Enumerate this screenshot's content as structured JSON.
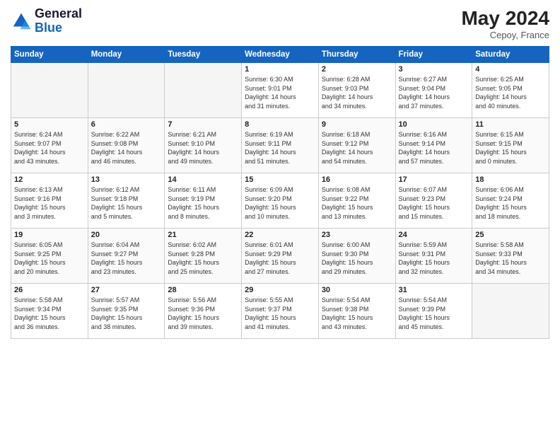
{
  "header": {
    "logo_general": "General",
    "logo_blue": "Blue",
    "month_year": "May 2024",
    "location": "Cepoy, France"
  },
  "days_of_week": [
    "Sunday",
    "Monday",
    "Tuesday",
    "Wednesday",
    "Thursday",
    "Friday",
    "Saturday"
  ],
  "weeks": [
    [
      {
        "day": "",
        "info": ""
      },
      {
        "day": "",
        "info": ""
      },
      {
        "day": "",
        "info": ""
      },
      {
        "day": "1",
        "info": "Sunrise: 6:30 AM\nSunset: 9:01 PM\nDaylight: 14 hours\nand 31 minutes."
      },
      {
        "day": "2",
        "info": "Sunrise: 6:28 AM\nSunset: 9:03 PM\nDaylight: 14 hours\nand 34 minutes."
      },
      {
        "day": "3",
        "info": "Sunrise: 6:27 AM\nSunset: 9:04 PM\nDaylight: 14 hours\nand 37 minutes."
      },
      {
        "day": "4",
        "info": "Sunrise: 6:25 AM\nSunset: 9:05 PM\nDaylight: 14 hours\nand 40 minutes."
      }
    ],
    [
      {
        "day": "5",
        "info": "Sunrise: 6:24 AM\nSunset: 9:07 PM\nDaylight: 14 hours\nand 43 minutes."
      },
      {
        "day": "6",
        "info": "Sunrise: 6:22 AM\nSunset: 9:08 PM\nDaylight: 14 hours\nand 46 minutes."
      },
      {
        "day": "7",
        "info": "Sunrise: 6:21 AM\nSunset: 9:10 PM\nDaylight: 14 hours\nand 49 minutes."
      },
      {
        "day": "8",
        "info": "Sunrise: 6:19 AM\nSunset: 9:11 PM\nDaylight: 14 hours\nand 51 minutes."
      },
      {
        "day": "9",
        "info": "Sunrise: 6:18 AM\nSunset: 9:12 PM\nDaylight: 14 hours\nand 54 minutes."
      },
      {
        "day": "10",
        "info": "Sunrise: 6:16 AM\nSunset: 9:14 PM\nDaylight: 14 hours\nand 57 minutes."
      },
      {
        "day": "11",
        "info": "Sunrise: 6:15 AM\nSunset: 9:15 PM\nDaylight: 15 hours\nand 0 minutes."
      }
    ],
    [
      {
        "day": "12",
        "info": "Sunrise: 6:13 AM\nSunset: 9:16 PM\nDaylight: 15 hours\nand 3 minutes."
      },
      {
        "day": "13",
        "info": "Sunrise: 6:12 AM\nSunset: 9:18 PM\nDaylight: 15 hours\nand 5 minutes."
      },
      {
        "day": "14",
        "info": "Sunrise: 6:11 AM\nSunset: 9:19 PM\nDaylight: 15 hours\nand 8 minutes."
      },
      {
        "day": "15",
        "info": "Sunrise: 6:09 AM\nSunset: 9:20 PM\nDaylight: 15 hours\nand 10 minutes."
      },
      {
        "day": "16",
        "info": "Sunrise: 6:08 AM\nSunset: 9:22 PM\nDaylight: 15 hours\nand 13 minutes."
      },
      {
        "day": "17",
        "info": "Sunrise: 6:07 AM\nSunset: 9:23 PM\nDaylight: 15 hours\nand 15 minutes."
      },
      {
        "day": "18",
        "info": "Sunrise: 6:06 AM\nSunset: 9:24 PM\nDaylight: 15 hours\nand 18 minutes."
      }
    ],
    [
      {
        "day": "19",
        "info": "Sunrise: 6:05 AM\nSunset: 9:25 PM\nDaylight: 15 hours\nand 20 minutes."
      },
      {
        "day": "20",
        "info": "Sunrise: 6:04 AM\nSunset: 9:27 PM\nDaylight: 15 hours\nand 23 minutes."
      },
      {
        "day": "21",
        "info": "Sunrise: 6:02 AM\nSunset: 9:28 PM\nDaylight: 15 hours\nand 25 minutes."
      },
      {
        "day": "22",
        "info": "Sunrise: 6:01 AM\nSunset: 9:29 PM\nDaylight: 15 hours\nand 27 minutes."
      },
      {
        "day": "23",
        "info": "Sunrise: 6:00 AM\nSunset: 9:30 PM\nDaylight: 15 hours\nand 29 minutes."
      },
      {
        "day": "24",
        "info": "Sunrise: 5:59 AM\nSunset: 9:31 PM\nDaylight: 15 hours\nand 32 minutes."
      },
      {
        "day": "25",
        "info": "Sunrise: 5:58 AM\nSunset: 9:33 PM\nDaylight: 15 hours\nand 34 minutes."
      }
    ],
    [
      {
        "day": "26",
        "info": "Sunrise: 5:58 AM\nSunset: 9:34 PM\nDaylight: 15 hours\nand 36 minutes."
      },
      {
        "day": "27",
        "info": "Sunrise: 5:57 AM\nSunset: 9:35 PM\nDaylight: 15 hours\nand 38 minutes."
      },
      {
        "day": "28",
        "info": "Sunrise: 5:56 AM\nSunset: 9:36 PM\nDaylight: 15 hours\nand 39 minutes."
      },
      {
        "day": "29",
        "info": "Sunrise: 5:55 AM\nSunset: 9:37 PM\nDaylight: 15 hours\nand 41 minutes."
      },
      {
        "day": "30",
        "info": "Sunrise: 5:54 AM\nSunset: 9:38 PM\nDaylight: 15 hours\nand 43 minutes."
      },
      {
        "day": "31",
        "info": "Sunrise: 5:54 AM\nSunset: 9:39 PM\nDaylight: 15 hours\nand 45 minutes."
      },
      {
        "day": "",
        "info": ""
      }
    ]
  ],
  "colors": {
    "header_bg": "#1565c0",
    "header_text": "#ffffff",
    "border": "#cccccc"
  }
}
